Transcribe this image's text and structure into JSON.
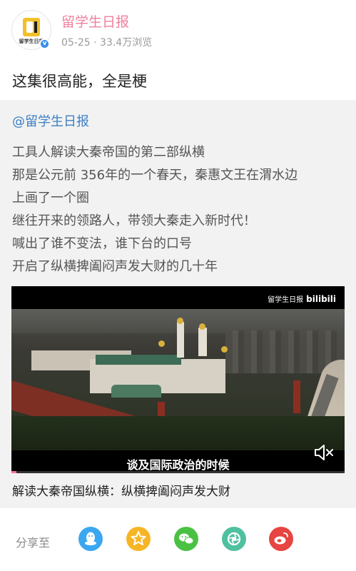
{
  "post": {
    "author": "留学生日报",
    "meta": "05-25 · 33.4万浏览",
    "avatar_text": "留学生日报",
    "verified_icon": "verified-v-icon",
    "title": "这集很高能，全是梗"
  },
  "repost": {
    "mention": "@留学生日报",
    "lines": [
      "工具人解读大秦帝国的第二部纵横",
      "那是公元前 356年的一个春天，秦惠文王在渭水边",
      "上画了一个圈",
      "继往开来的领路人，带领大秦走入新时代！",
      "喊出了谁不变法，谁下台的口号",
      "开启了纵横捭阖闷声发大财的几十年"
    ],
    "video": {
      "watermark": "留学生日报",
      "platform": "bilibili",
      "subtitle": "谈及国际政治的时候",
      "mute_icon": "volume-mute-icon",
      "progress_accent": "#fb7299"
    },
    "caption": "解读大秦帝国纵横：纵横捭阖闷声发大财"
  },
  "share": {
    "label": "分享至",
    "targets": [
      {
        "name": "qq",
        "icon": "qq-icon",
        "color": "#3aa7f0"
      },
      {
        "name": "qzone",
        "icon": "qzone-star-icon",
        "color": "#f7b526"
      },
      {
        "name": "wechat",
        "icon": "wechat-icon",
        "color": "#4bc144"
      },
      {
        "name": "moments",
        "icon": "moments-icon",
        "color": "#4fc0a0"
      },
      {
        "name": "weibo",
        "icon": "weibo-icon",
        "color": "#e64541"
      }
    ]
  },
  "colors": {
    "author": "#ef7f9d",
    "mention": "#3b7fc4",
    "repost_bg": "#f2f2f2"
  }
}
